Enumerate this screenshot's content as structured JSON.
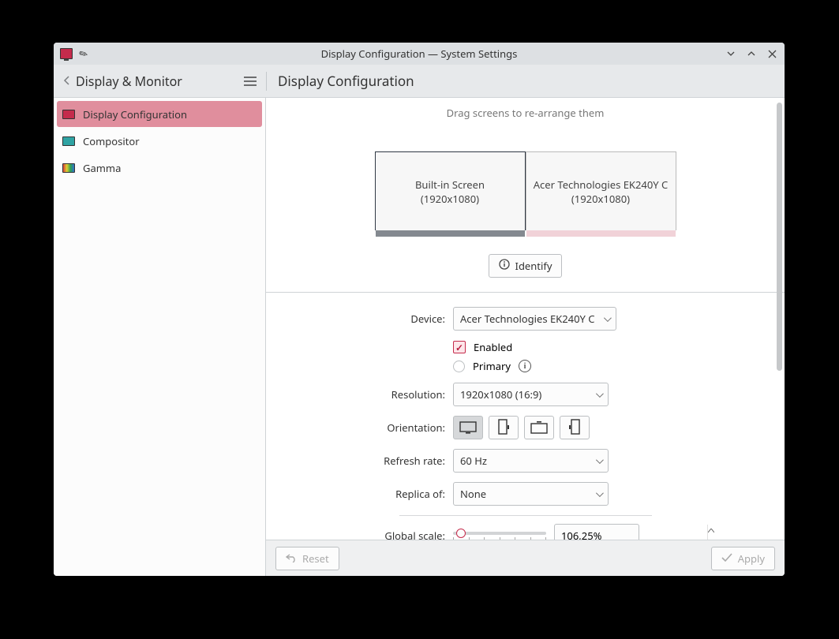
{
  "titlebar": {
    "title": "Display Configuration — System Settings"
  },
  "sidebar": {
    "back_label": "Display & Monitor",
    "items": [
      {
        "label": "Display Configuration"
      },
      {
        "label": "Compositor"
      },
      {
        "label": "Gamma"
      }
    ]
  },
  "main": {
    "title": "Display Configuration",
    "drag_hint": "Drag screens to re-arrange them",
    "monitors": [
      {
        "name": "Built-in Screen",
        "res": "(1920x1080)"
      },
      {
        "name": "Acer Technologies EK240Y C",
        "res": "(1920x1080)"
      }
    ],
    "identify": "Identify",
    "form": {
      "device_label": "Device:",
      "device_value": "Acer Technologies EK240Y C",
      "enabled_label": "Enabled",
      "primary_label": "Primary",
      "resolution_label": "Resolution:",
      "resolution_value": "1920x1080 (16:9)",
      "orientation_label": "Orientation:",
      "refresh_label": "Refresh rate:",
      "refresh_value": "60 Hz",
      "replica_label": "Replica of:",
      "replica_value": "None",
      "scale_label": "Global scale:",
      "scale_value": "106,25%"
    }
  },
  "footer": {
    "reset": "Reset",
    "apply": "Apply"
  }
}
